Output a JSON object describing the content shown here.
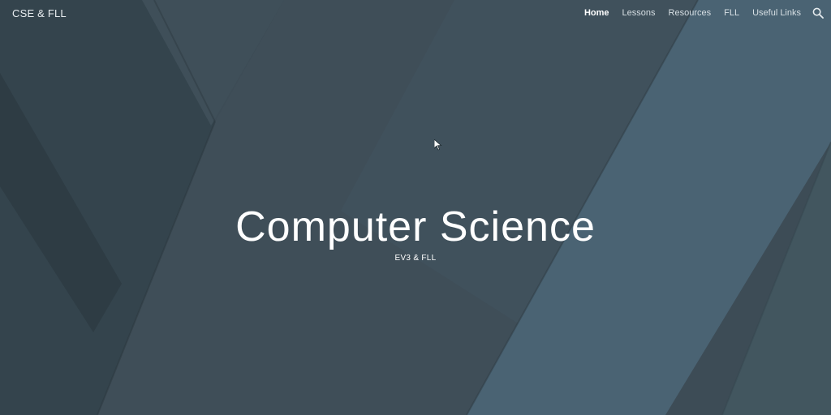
{
  "header": {
    "site_title": "CSE & FLL",
    "nav": [
      {
        "label": "Home",
        "active": true
      },
      {
        "label": "Lessons",
        "active": false
      },
      {
        "label": "Resources",
        "active": false
      },
      {
        "label": "FLL",
        "active": false
      },
      {
        "label": "Useful Links",
        "active": false
      }
    ],
    "search_icon": "search-icon"
  },
  "hero": {
    "title": "Computer Science",
    "subtitle": "EV3 & FLL"
  },
  "colors": {
    "background_base": "#3b4a55",
    "band_dark": "#2f3d46",
    "band_mid": "#42525d",
    "band_light": "#4a6474",
    "text": "#ffffff"
  }
}
